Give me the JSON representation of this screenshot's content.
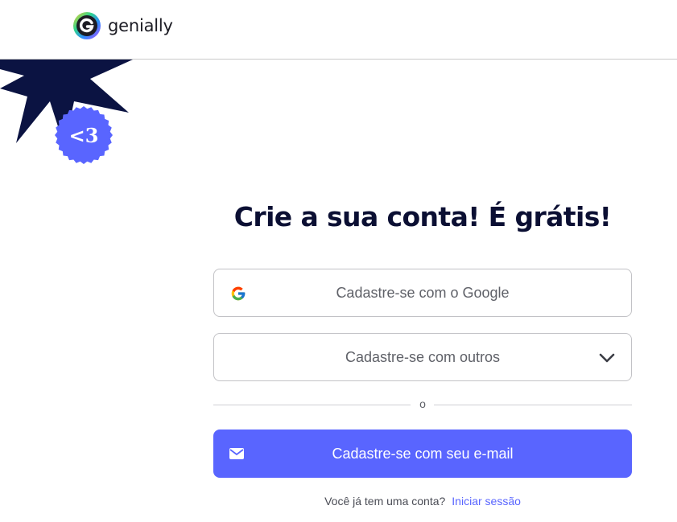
{
  "header": {
    "logo_text": "genially",
    "logo_icon": "genially-logo-icon"
  },
  "decoration": {
    "badge_text": "<3",
    "colors": {
      "star": "#0b1342",
      "badge": "#5965ff"
    }
  },
  "main": {
    "title": "Crie a sua conta! É grátis!",
    "google_button": {
      "label": "Cadastre-se com o Google",
      "icon": "google-icon"
    },
    "others_button": {
      "label": "Cadastre-se com outros",
      "icon": "chevron-down-icon"
    },
    "divider_text": "o",
    "email_button": {
      "label": "Cadastre-se com seu e-mail",
      "icon": "envelope-icon"
    },
    "footer": {
      "question": "Você já tem uma conta?",
      "login_link": "Iniciar sessão"
    }
  },
  "colors": {
    "accent": "#5965ff",
    "title": "#0b0f33",
    "border": "#c2c2c6"
  }
}
